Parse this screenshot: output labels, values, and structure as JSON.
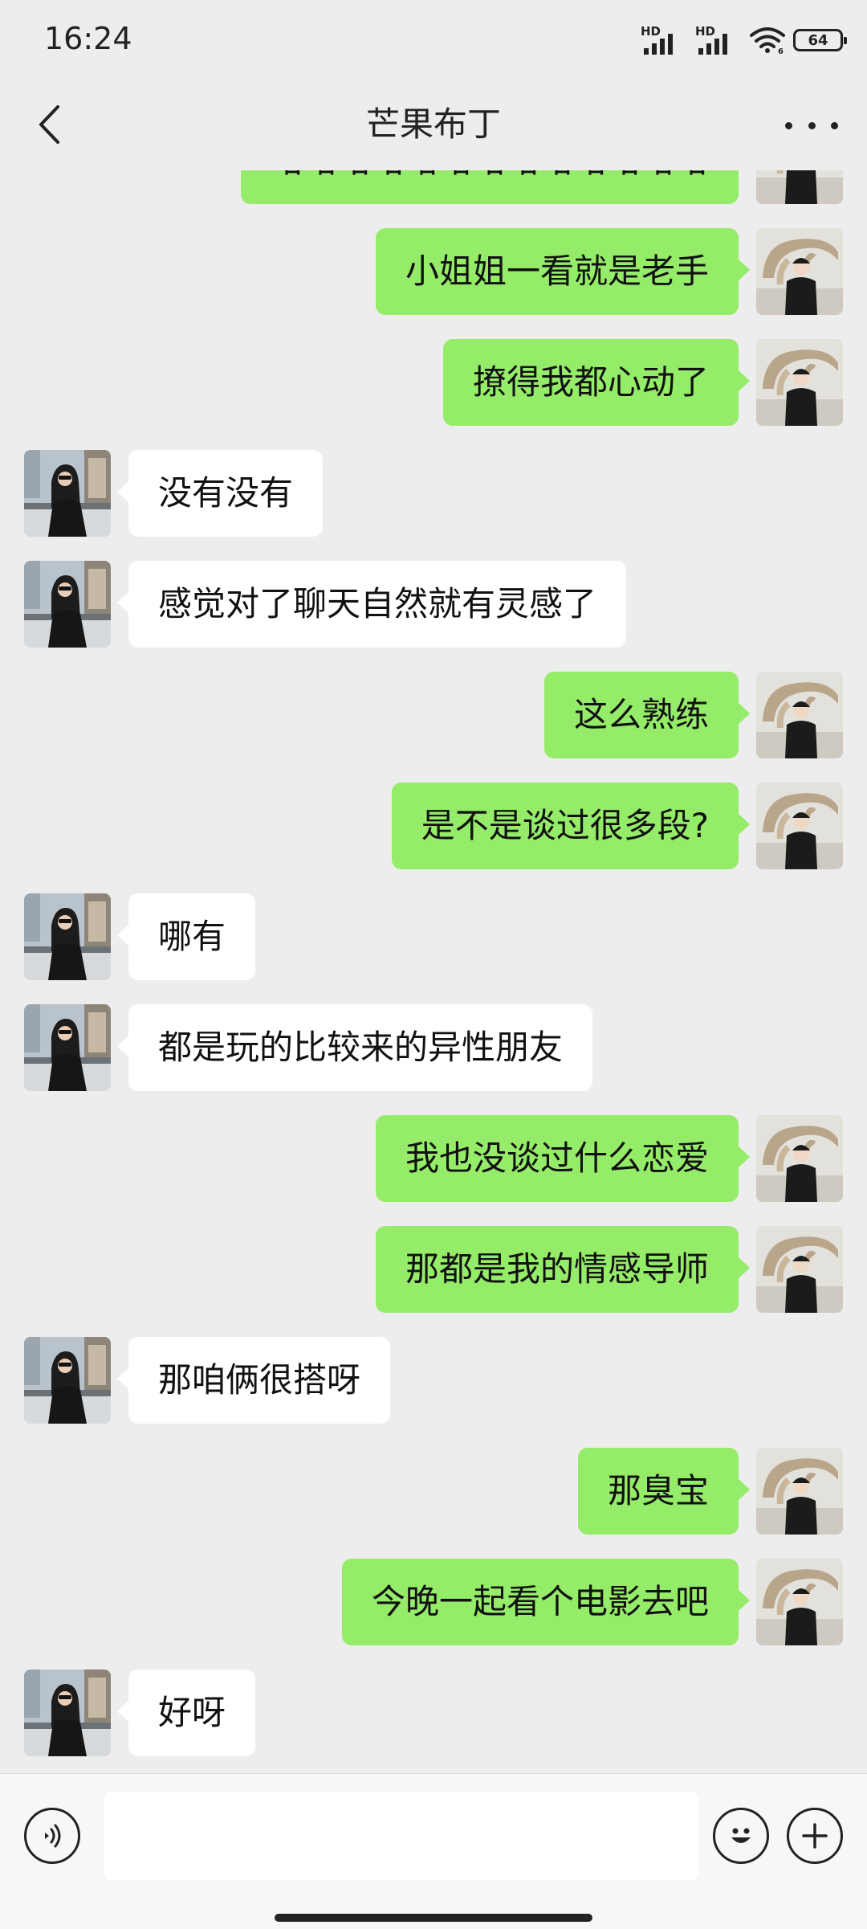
{
  "status_bar": {
    "time": "16:24",
    "signal_1_label": "HD",
    "signal_2_label": "HD",
    "signal_2_sub": "6",
    "battery": "64"
  },
  "nav": {
    "title": "芒果布丁",
    "back_icon": "chevron-left-icon",
    "more_icon": "more-horizontal-icon"
  },
  "messages": [
    {
      "side": "out",
      "text": "哈哈哈哈哈哈哈哈哈哈哈哈哈"
    },
    {
      "side": "out",
      "text": "小姐姐一看就是老手"
    },
    {
      "side": "out",
      "text": "撩得我都心动了"
    },
    {
      "side": "in",
      "text": "没有没有"
    },
    {
      "side": "in",
      "text": "感觉对了聊天自然就有灵感了"
    },
    {
      "side": "out",
      "text": "这么熟练"
    },
    {
      "side": "out",
      "text": "是不是谈过很多段?"
    },
    {
      "side": "in",
      "text": "哪有"
    },
    {
      "side": "in",
      "text": "都是玩的比较来的异性朋友"
    },
    {
      "side": "out",
      "text": "我也没谈过什么恋爱"
    },
    {
      "side": "out",
      "text": "那都是我的情感导师"
    },
    {
      "side": "in",
      "text": "那咱俩很搭呀"
    },
    {
      "side": "out",
      "text": "那臭宝"
    },
    {
      "side": "out",
      "text": "今晚一起看个电影去吧"
    },
    {
      "side": "in",
      "text": "好呀"
    }
  ],
  "input": {
    "value": "",
    "voice_icon": "voice-icon",
    "emoji_icon": "emoji-icon",
    "plus_icon": "plus-icon"
  },
  "colors": {
    "background": "#ededed",
    "outgoing_bubble": "#95ec69",
    "incoming_bubble": "#ffffff"
  }
}
